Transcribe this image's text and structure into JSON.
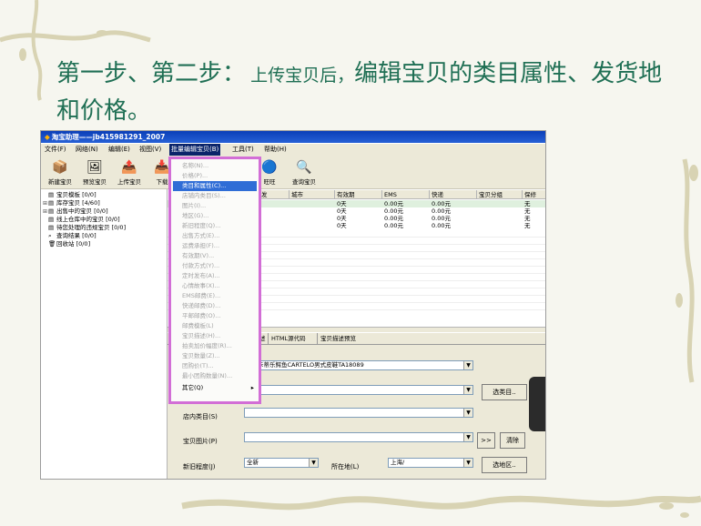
{
  "slide": {
    "heading_big": "第一步、第二步：",
    "heading_small_1": "上传宝贝后，",
    "heading_rest": "编辑宝贝的类目属性、发货地和价格。"
  },
  "app": {
    "title": "淘宝助理——jb415981291_2007",
    "menubar": [
      "文件(F)",
      "网络(N)",
      "编辑(E)",
      "视图(V)",
      "批量编辑宝贝(B)",
      "工具(T)",
      "帮助(H)"
    ],
    "toolbar": [
      "新建宝贝",
      "预览宝贝",
      "上传宝贝",
      "下载",
      "旺旺",
      "查询宝贝"
    ],
    "tree": [
      {
        "label": "宝贝模板 [0/0]"
      },
      {
        "label": "库存宝贝 [4/60]"
      },
      {
        "label": "出售中的宝贝 [0/0]"
      },
      {
        "label": "线上仓库中的宝贝 [0/0]"
      },
      {
        "label": "待您处理的违规宝贝 [0/0]"
      },
      {
        "label": "查询结果 [0/0]"
      },
      {
        "label": "回收站 [0/0]"
      }
    ],
    "table": {
      "headers": [
        "发",
        "城市",
        "有效期",
        "EMS",
        "快递",
        "宝贝分组",
        "保修"
      ],
      "rows": [
        [
          "",
          "",
          "0天",
          "0.00元",
          "0.00元",
          "",
          "无"
        ],
        [
          "",
          "",
          "0天",
          "0.00元",
          "0.00元",
          "",
          "无"
        ],
        [
          "",
          "",
          "0天",
          "0.00元",
          "0.00元",
          "",
          "无"
        ],
        [
          "",
          "",
          "0天",
          "0.00元",
          "0.00元",
          "",
          "无"
        ]
      ]
    },
    "detail_tabs": [
      "述",
      "HTML源代码",
      "宝贝描述预览"
    ],
    "form": {
      "title_value": "卡蒂乐鳄鱼CARTELO男式皮鞋TA18089",
      "store_category_label": "店内类目(S)",
      "images_label": "宝贝图片(P)",
      "condition_label": "新旧程度(J)",
      "condition_value": "全新",
      "location_label": "所在地(L)",
      "location_value": "上海/",
      "choose_category_btn": "选类目..",
      "more_btn": ">>",
      "clear_btn": "清除",
      "choose_area_btn": "选地区.."
    },
    "batch_menu": [
      "名称(N)...",
      "价格(P)...",
      "类目和属性(C)...",
      "店铺内类目(S)...",
      "图片(I)...",
      "地区(G)...",
      "新旧程度(Q)...",
      "出售方式(E)...",
      "运费承担(F)...",
      "有效期(V)...",
      "付款方式(Y)...",
      "定时发布(A)...",
      "心情故事(X)...",
      "EMS邮费(E)...",
      "快递邮费(D)...",
      "平邮邮费(O)...",
      "邮费模板(L)",
      "宝贝描述(H)...",
      "拍卖加价幅度(R)...",
      "宝贝数量(Z)...",
      "团购价(T)...",
      "最小团购数量(N)...",
      "其它(Q)"
    ],
    "batch_menu_highlight_index": 2,
    "accent": "#d26ed6",
    "highlight": "#2f6dd6"
  }
}
